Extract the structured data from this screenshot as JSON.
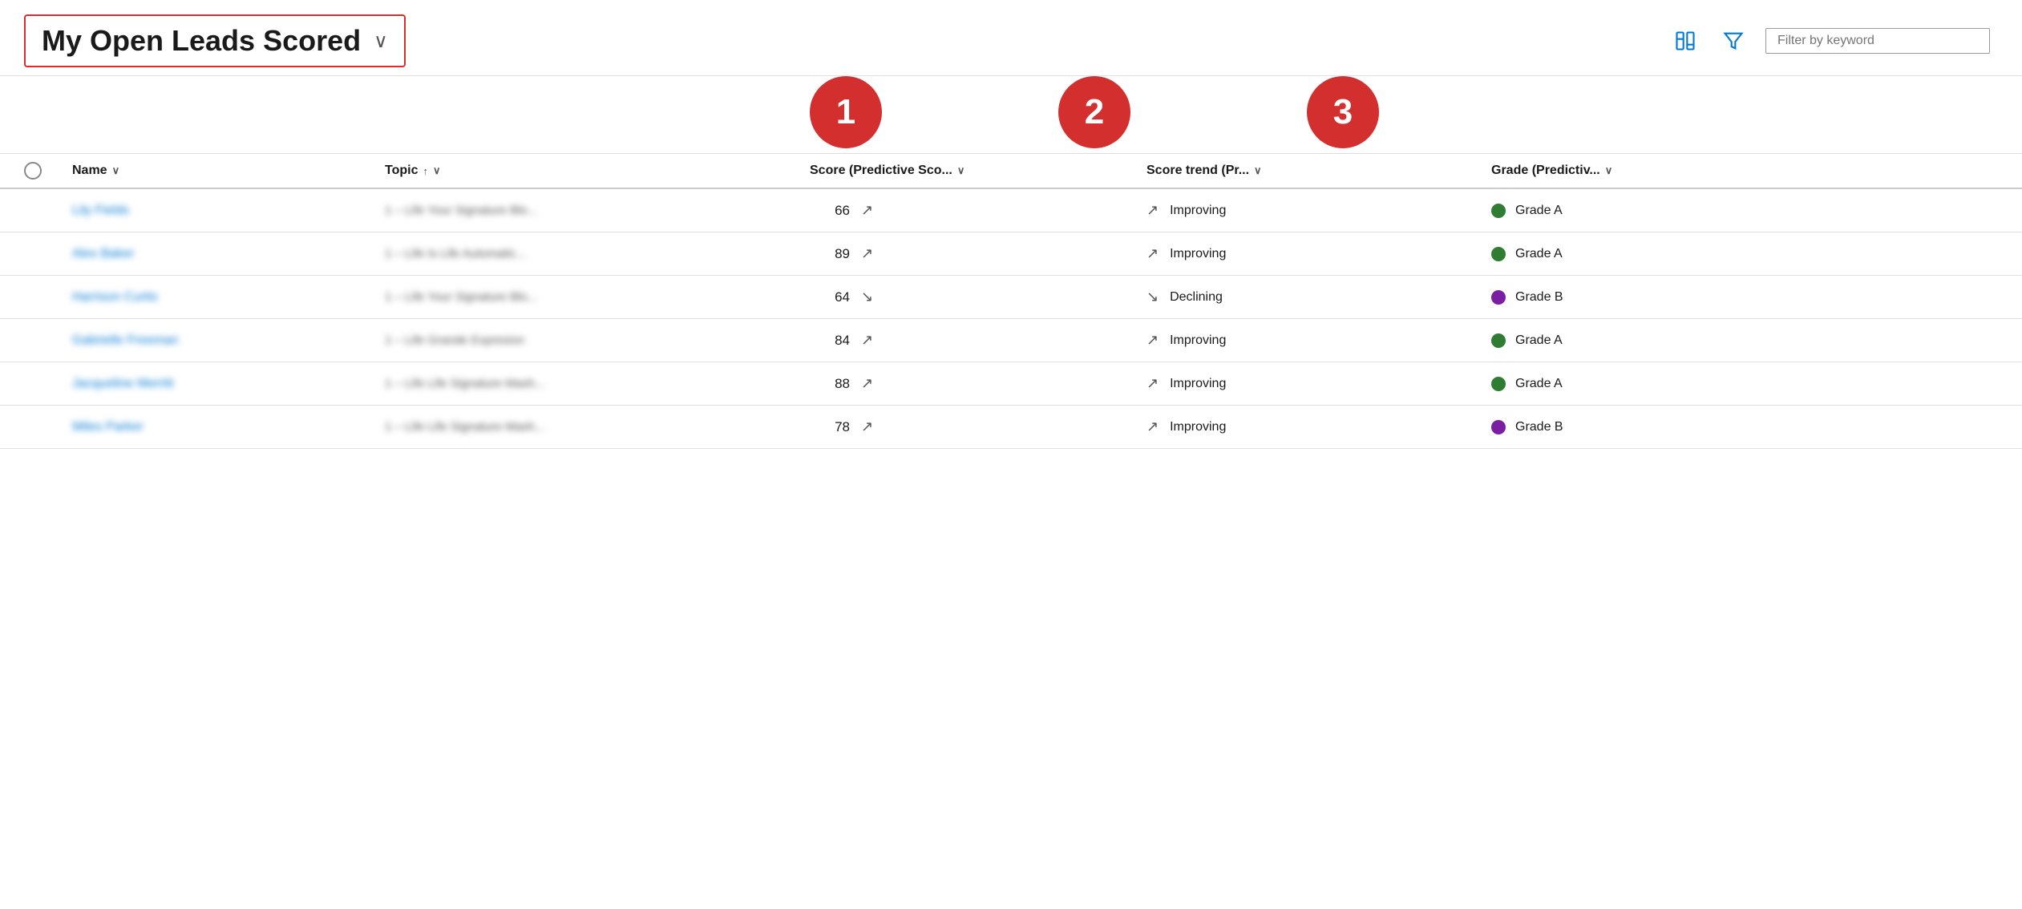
{
  "header": {
    "title": "My Open Leads Scored",
    "chevron": "∨",
    "filter_placeholder": "Filter by keyword"
  },
  "badges": [
    {
      "label": "1"
    },
    {
      "label": "2"
    },
    {
      "label": "3"
    }
  ],
  "columns": {
    "check": "",
    "name": "Name",
    "topic": "Topic",
    "score": "Score (Predictive Sco...",
    "trend": "Score trend (Pr...",
    "grade": "Grade (Predictiv..."
  },
  "rows": [
    {
      "name": "Lily Fields",
      "topic": "1 – Life Your Signature Blo...",
      "score": 66,
      "trend_direction": "up",
      "trend_label": "Improving",
      "grade_color": "green",
      "grade_label": "Grade A"
    },
    {
      "name": "Alex Baker",
      "topic": "1 – Life Is Life Automatic...",
      "score": 89,
      "trend_direction": "up",
      "trend_label": "Improving",
      "grade_color": "green",
      "grade_label": "Grade A"
    },
    {
      "name": "Harrison Curtis",
      "topic": "1 – Life Your Signature Blo...",
      "score": 64,
      "trend_direction": "down",
      "trend_label": "Declining",
      "grade_color": "purple",
      "grade_label": "Grade B"
    },
    {
      "name": "Gabrielle Freeman",
      "topic": "1 – Life Grande Expresion",
      "score": 84,
      "trend_direction": "up",
      "trend_label": "Improving",
      "grade_color": "green",
      "grade_label": "Grade A"
    },
    {
      "name": "Jacqueline Merritt",
      "topic": "1 – Life Life Signature Mash...",
      "score": 88,
      "trend_direction": "up",
      "trend_label": "Improving",
      "grade_color": "green",
      "grade_label": "Grade A"
    },
    {
      "name": "Miles Parker",
      "topic": "1 – Life Life Signature Mash...",
      "score": 78,
      "trend_direction": "up",
      "trend_label": "Improving",
      "grade_color": "purple",
      "grade_label": "Grade B"
    }
  ]
}
